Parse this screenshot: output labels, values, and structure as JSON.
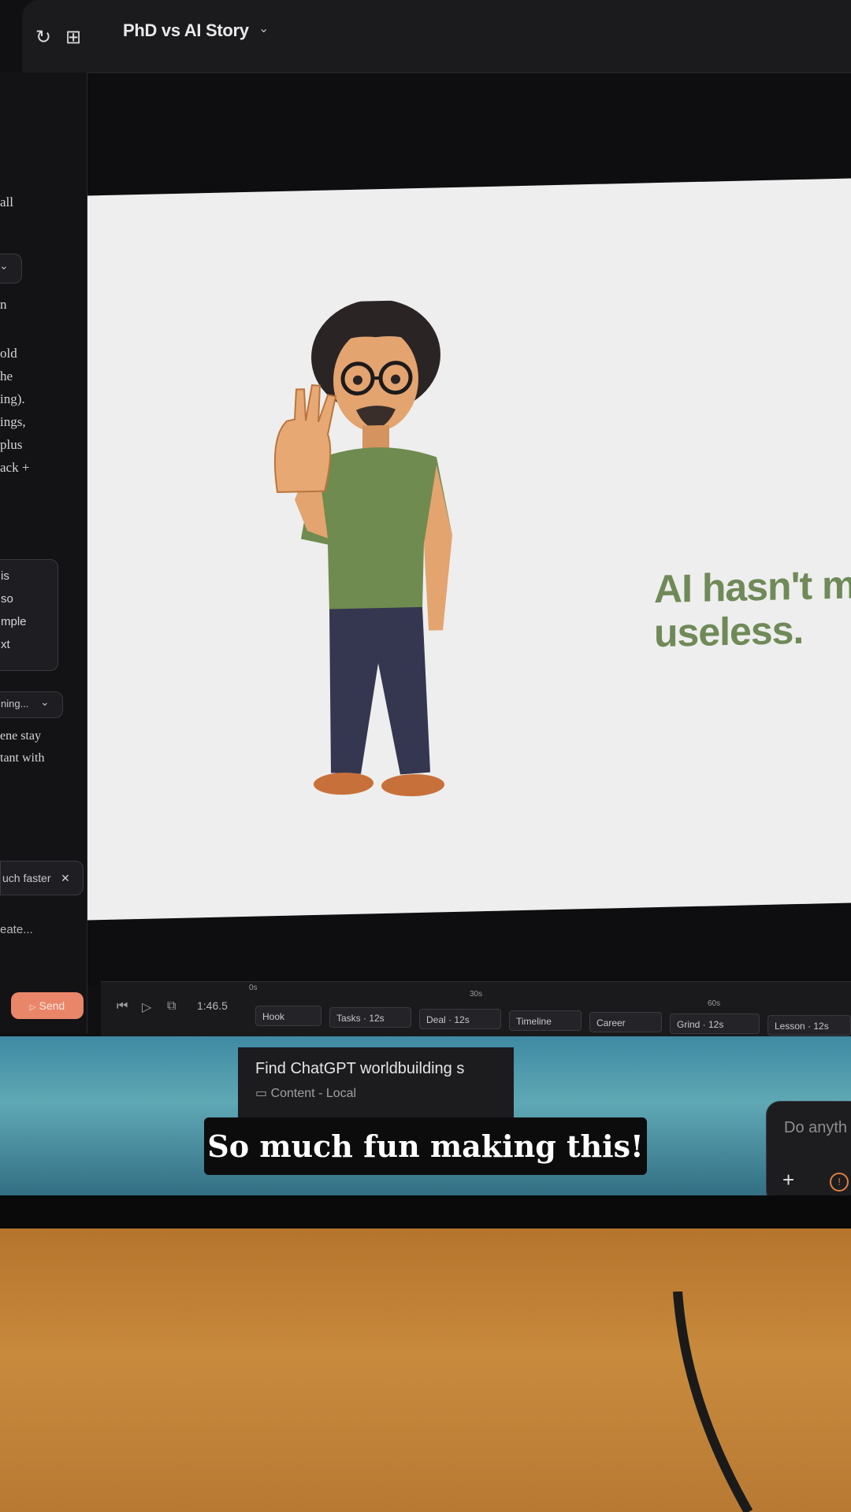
{
  "app": {
    "project_title": "PhD vs AI Story",
    "icons": [
      "refresh-icon",
      "layout-icon",
      "chevron-down-icon"
    ]
  },
  "sidebar": {
    "lines": [
      "all",
      "n",
      "old",
      "he",
      "ing).",
      "ings,",
      "plus",
      "ack +"
    ],
    "chip_lines": [
      "is",
      "so",
      "mple",
      "xt"
    ],
    "thinking_label": "ning...",
    "reply_lines": [
      "ene stay",
      "tant with"
    ],
    "pending_label": "uch faster",
    "input_placeholder": "eate...",
    "send_label": "Send"
  },
  "canvas": {
    "headline": "AI hasn't mac\nuseless."
  },
  "timeline": {
    "timecode": "1:46.5",
    "ticks": [
      "0s",
      "30s",
      "60s"
    ],
    "segments": [
      "Hook",
      "Tasks · 12s",
      "Deal · 12s",
      "Timeline",
      "Career",
      "Grind · 12s",
      "Lesson · 12s"
    ]
  },
  "taskbar": {
    "notification_title": "Find ChatGPT worldbuilding s",
    "notification_sub": "Content - Local",
    "assistant_placeholder": "Do anyth"
  },
  "caption": "So much fun making this!",
  "colors": {
    "accent_send": "#e9866a",
    "headline_green": "#6f8a58",
    "shirt_green": "#6f8b4f",
    "pants_navy": "#353650"
  }
}
